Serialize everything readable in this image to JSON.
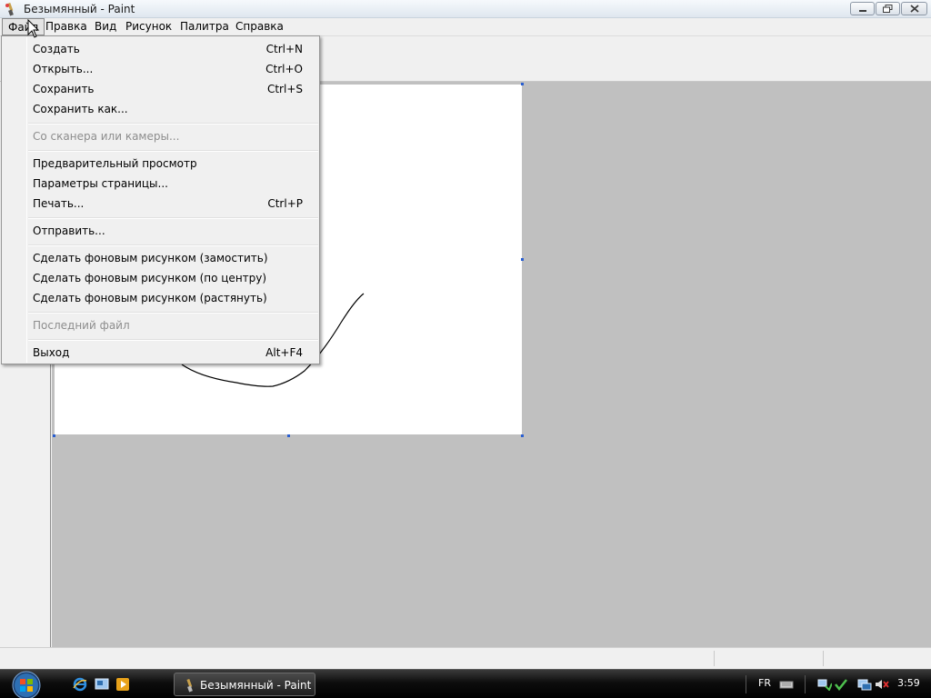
{
  "window": {
    "title": "Безымянный - Paint",
    "app_icon": "paint-brush-icon",
    "controls": [
      "minimize-icon",
      "maximize-icon",
      "close-icon"
    ]
  },
  "menubar": {
    "items": [
      {
        "label": "Файл",
        "active": true
      },
      {
        "label": "Правка"
      },
      {
        "label": "Вид"
      },
      {
        "label": "Рисунок"
      },
      {
        "label": "Палитра"
      },
      {
        "label": "Справка"
      }
    ]
  },
  "file_menu": {
    "items": [
      {
        "label": "Создать",
        "shortcut": "Ctrl+N",
        "enabled": true
      },
      {
        "label": "Открыть...",
        "shortcut": "Ctrl+O",
        "enabled": true
      },
      {
        "label": "Сохранить",
        "shortcut": "Ctrl+S",
        "enabled": true
      },
      {
        "label": "Сохранить как...",
        "shortcut": "",
        "enabled": true
      },
      {
        "label": "Со сканера или камеры...",
        "shortcut": "",
        "enabled": false
      },
      {
        "label": "Предварительный просмотр",
        "shortcut": "",
        "enabled": true
      },
      {
        "label": "Параметры страницы...",
        "shortcut": "",
        "enabled": true
      },
      {
        "label": "Печать...",
        "shortcut": "Ctrl+P",
        "enabled": true
      },
      {
        "label": "Отправить...",
        "shortcut": "",
        "enabled": true
      },
      {
        "label": "Сделать фоновым рисунком (замостить)",
        "shortcut": "",
        "enabled": true
      },
      {
        "label": "Сделать фоновым рисунком (по центру)",
        "shortcut": "",
        "enabled": true
      },
      {
        "label": "Сделать фоновым рисунком (растянуть)",
        "shortcut": "",
        "enabled": true
      },
      {
        "label": "Последний файл",
        "shortcut": "",
        "enabled": false
      },
      {
        "label": "Выход",
        "shortcut": "Alt+F4",
        "enabled": true
      }
    ]
  },
  "colors": {
    "workspace_bg": "#c0c0c0",
    "canvas_bg": "#ffffff",
    "resize_handle": "#2a5fd1",
    "disabled_text": "#8d8d8d"
  },
  "taskbar": {
    "start_icon": "windows-start-orb-icon",
    "quick_launch": [
      "internet-explorer-icon",
      "show-desktop-icon",
      "media-player-icon"
    ],
    "task_button": {
      "label": "Безымянный - Paint",
      "icon": "paint-brush-icon"
    },
    "tray": {
      "language": "FR",
      "icons": [
        "keyboard-icon",
        "network-icon",
        "volume-muted-icon",
        "display-icon"
      ],
      "clock": "3:59"
    }
  }
}
